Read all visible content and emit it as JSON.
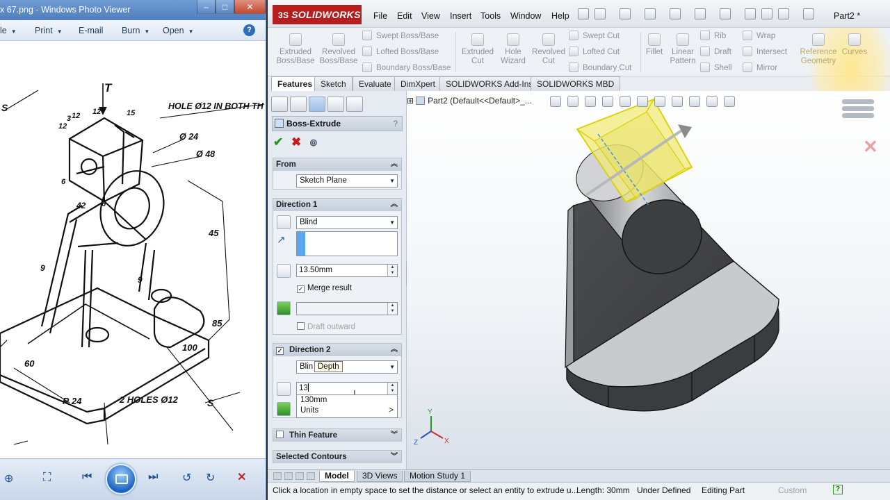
{
  "photo_viewer": {
    "title": "x 67.png - Windows Photo Viewer",
    "window_buttons": [
      "–",
      "□",
      "✕"
    ],
    "menu": [
      {
        "label": "le",
        "caret": true
      },
      {
        "label": "Print",
        "caret": true
      },
      {
        "label": "E-mail",
        "caret": false
      },
      {
        "label": "Burn",
        "caret": true
      },
      {
        "label": "Open",
        "caret": true
      }
    ],
    "help": "?",
    "drawing_labels": {
      "t": "T",
      "hole_top": "HOLE Ø12 IN BOTH TH",
      "d24": "Ø 24",
      "d48": "Ø 48",
      "n12a": "12",
      "n3a": "3",
      "n12b": "12",
      "n12c": "12",
      "n15": "15",
      "n6a": "6",
      "n6b": "6",
      "n42": "42",
      "n45": "45",
      "n9a": "9",
      "n9b": "9",
      "n85": "85",
      "n100": "100",
      "n60": "60",
      "r24": "R 24",
      "holes": "2 HOLES Ø12",
      "s_right": "S",
      "s_left": "S"
    }
  },
  "solidworks": {
    "logo": "SOLIDWORKS",
    "logo_ds": "3S",
    "menu": [
      "File",
      "Edit",
      "View",
      "Insert",
      "Tools",
      "Window",
      "Help"
    ],
    "part_name": "Part2 *",
    "help": "?",
    "ribbon": {
      "extruded_boss": "Extruded\nBoss/Base",
      "revolved_boss": "Revolved\nBoss/Base",
      "swept_boss": "Swept Boss/Base",
      "lofted_boss": "Lofted Boss/Base",
      "boundary_boss": "Boundary Boss/Base",
      "extruded_cut": "Extruded\nCut",
      "hole_wizard": "Hole\nWizard",
      "revolved_cut": "Revolved\nCut",
      "swept_cut": "Swept Cut",
      "lofted_cut": "Lofted Cut",
      "boundary_cut": "Boundary Cut",
      "fillet": "Fillet",
      "linear_pattern": "Linear\nPattern",
      "rib": "Rib",
      "draft": "Draft",
      "shell": "Shell",
      "wrap": "Wrap",
      "intersect": "Intersect",
      "mirror": "Mirror",
      "reference_geometry": "Reference\nGeometry",
      "curves": "Curves"
    },
    "tabs": [
      "Features",
      "Sketch",
      "Evaluate",
      "DimXpert",
      "SOLIDWORKS Add-Ins",
      "SOLIDWORKS MBD"
    ],
    "active_tab": "Features",
    "property_manager": {
      "title": "Boss-Extrude",
      "help": "?",
      "ok": "✔",
      "cancel": "✖",
      "from": {
        "header": "From",
        "value": "Sketch Plane"
      },
      "direction1": {
        "header": "Direction 1",
        "end_condition": "Blind",
        "depth": "13.50mm",
        "merge_result": "Merge result",
        "draft_outward": "Draft outward"
      },
      "direction2": {
        "header": "Direction 2",
        "end_condition": "Blin",
        "depth_input": "13",
        "tooltip": "Depth",
        "suggestions": [
          "130mm",
          "Units"
        ],
        "units_more": ">"
      },
      "thin_feature": "Thin Feature",
      "selected_contours": "Selected Contours"
    },
    "graphics": {
      "tree_item": "Part2  (Default<<Default>_...",
      "triad": {
        "x": "X",
        "y": "Y",
        "z": "Z"
      }
    },
    "bottom_tabs": [
      "Model",
      "3D Views",
      "Motion Study 1"
    ],
    "status": {
      "message": "Click a location in empty space to set the distance or select an entity to extrude u...",
      "length": "Length: 30mm",
      "defined": "Under Defined",
      "mode": "Editing Part",
      "custom": "Custom"
    }
  }
}
